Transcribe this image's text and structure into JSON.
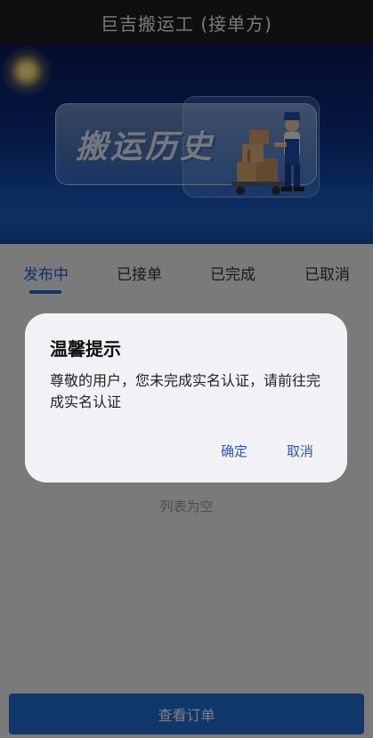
{
  "header": {
    "title": "巨吉搬运工 (接单方)"
  },
  "banner": {
    "title": "搬运历史"
  },
  "tabs": [
    {
      "label": "发布中",
      "active": true
    },
    {
      "label": "已接单",
      "active": false
    },
    {
      "label": "已完成",
      "active": false
    },
    {
      "label": "已取消",
      "active": false
    }
  ],
  "list": {
    "empty_text": "列表为空"
  },
  "footer": {
    "button_label": "查看订单"
  },
  "dialog": {
    "title": "温馨提示",
    "message": "尊敬的用户，您未完成实名认证，请前往完成实名认证",
    "confirm_label": "确定",
    "cancel_label": "取消"
  },
  "colors": {
    "accent": "#1f66c8",
    "dialog_button": "#2a57b8",
    "header_bg": "#1f1f1f"
  }
}
